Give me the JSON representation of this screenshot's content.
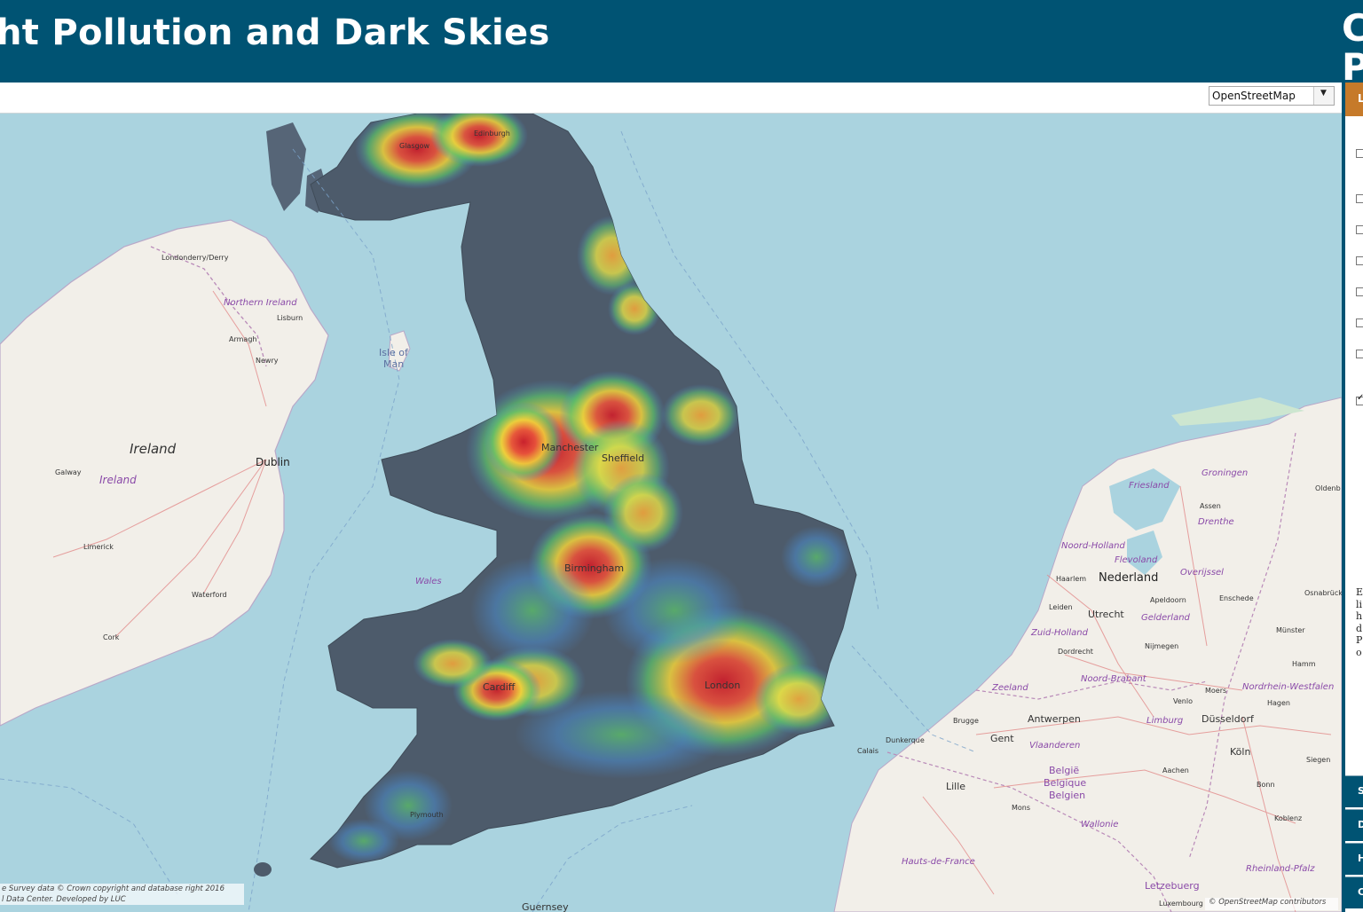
{
  "header": {
    "title": "ht Pollution and Dark Skies",
    "logo_letters": [
      "C",
      "P"
    ]
  },
  "toolbar": {
    "basemap_selected": "OpenStreetMap"
  },
  "map": {
    "labels": {
      "ireland_country": "Ireland",
      "ireland_region": "Ireland",
      "northern_ireland": "Northern Ireland",
      "londonderry": "Londonderry/Derry",
      "lisburn": "Lisburn",
      "armagh": "Armagh",
      "newry": "Newry",
      "dublin": "Dublin",
      "galway": "Galway",
      "limerick": "Limerick",
      "waterford": "Waterford",
      "cork": "Cork",
      "isle_of_man_1": "Isle of",
      "isle_of_man_2": "Man",
      "glasgow": "Glasgow",
      "edinburgh": "Edinburgh",
      "manchester": "Manchester",
      "sheffield": "Sheffield",
      "birmingham": "Birmingham",
      "london": "London",
      "cardiff": "Cardiff",
      "wales": "Wales",
      "plymouth": "Plymouth",
      "guernsey": "Guernsey",
      "nederland": "Nederland",
      "friesland": "Friesland",
      "groningen": "Groningen",
      "assen": "Assen",
      "drenthe": "Drenthe",
      "oldenburg": "Oldenb",
      "noord_holland": "Noord-Holland",
      "flevoland": "Flevoland",
      "overijssel": "Overijssel",
      "haarlem": "Haarlem",
      "apeldoorn": "Apeldoorn",
      "enschede": "Enschede",
      "osnabruck": "Osnabrück",
      "utrecht": "Utrecht",
      "gelderland": "Gelderland",
      "leiden": "Leiden",
      "zuid_holland": "Zuid-Holland",
      "nijmegen": "Nijmegen",
      "dordrecht": "Dordrecht",
      "munster": "Münster",
      "hamm": "Hamm",
      "noord_brabant": "Noord-Brabant",
      "zeeland": "Zeeland",
      "moers": "Moers",
      "nordrhein": "Nordrhein-Westfalen",
      "hagen": "Hagen",
      "venlo": "Venlo",
      "antwerpen": "Antwerpen",
      "brugge": "Brugge",
      "limburg": "Limburg",
      "dusseldorf": "Düsseldorf",
      "gent": "Gent",
      "vlaanderen": "Vlaanderen",
      "dunkerque": "Dunkerque",
      "calais": "Calais",
      "belgie": "België",
      "belgique": "Belgique",
      "belgien": "Belgien",
      "aachen": "Aachen",
      "koln": "Köln",
      "siegen": "Siegen",
      "lille": "Lille",
      "mons": "Mons",
      "bonn": "Bonn",
      "wallonie": "Wallonie",
      "koblenz": "Koblenz",
      "hauts_de_france": "Hauts-de-France",
      "rheinland_pfalz": "Rheinland-Pfalz",
      "letzebuerg": "Letzebuerg",
      "luxembourg": "Luxembourg"
    },
    "attribution_left_line1": "e Survey data © Crown copyright and database right 2016",
    "attribution_left_line2": "l Data Center. Developed by LUC",
    "attribution_right": "© OpenStreetMap contributors"
  },
  "panel": {
    "top_tab": "L",
    "text_lines": [
      "E",
      "li",
      "h",
      "d",
      "P",
      "o"
    ],
    "tabs": [
      "S",
      "D",
      "H",
      "C"
    ]
  },
  "colors": {
    "header_bg": "#005373",
    "accent_orange": "#c67a2a",
    "sea": "#aad3df",
    "land": "#f2efe9",
    "dark_sky": "#4d5b6b"
  }
}
